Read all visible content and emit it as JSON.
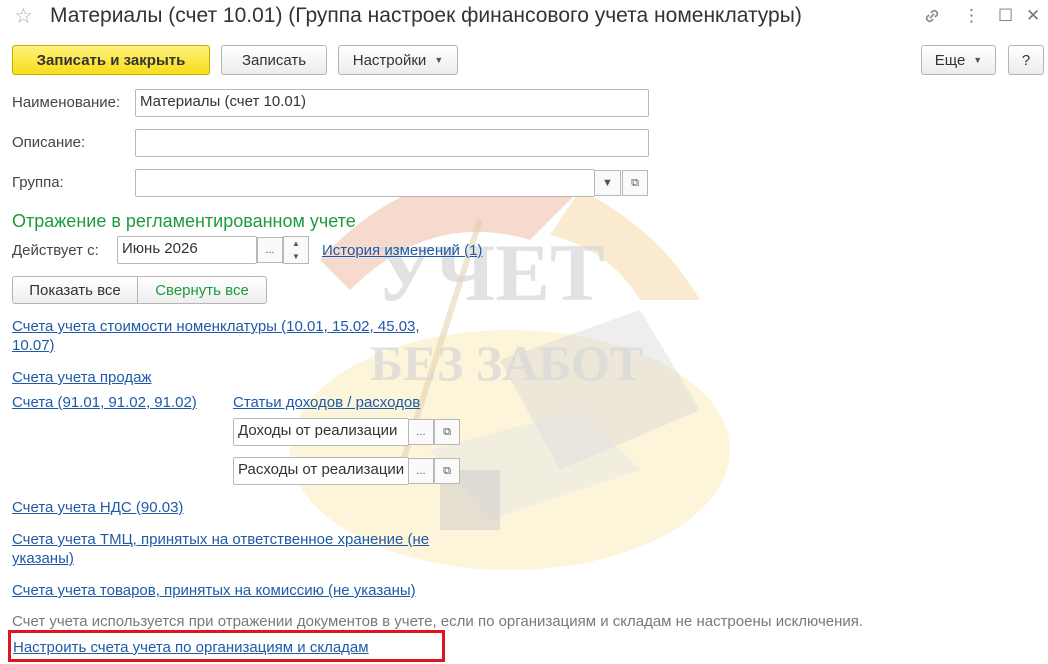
{
  "window": {
    "title": "Материалы (счет 10.01) (Группа настроек финансового учета номенклатуры)",
    "icons": [
      "star-icon",
      "link-icon",
      "more-icon",
      "maximize-icon",
      "close-icon"
    ]
  },
  "toolbar": {
    "save_close_label": "Записать и закрыть",
    "save_label": "Записать",
    "settings_label": "Настройки",
    "more_label": "Еще",
    "help_label": "?"
  },
  "form": {
    "name_label": "Наименование:",
    "name_value": "Материалы (счет 10.01)",
    "description_label": "Описание:",
    "description_value": "",
    "group_label": "Группа:",
    "group_value": ""
  },
  "section": {
    "title": "Отражение в регламентированном учете",
    "effective_label": "Действует с:",
    "effective_value": "Июнь 2026",
    "history_link": "История изменений (1)",
    "show_all": "Показать все",
    "collapse_all": "Свернуть все"
  },
  "links": {
    "cost_accounts_line1": "Счета учета стоимости номенклатуры (10.01, 15.02, 45.03,",
    "cost_accounts_line2": "10.07)",
    "sales_accounts": "Счета учета продаж",
    "accounts_91": "Счета (91.01, 91.02, 91.02)",
    "income_expense_items": "Статьи доходов / расходов",
    "income_field": "Доходы от реализации",
    "expense_field": "Расходы от реализации",
    "vat_accounts": "Счета учета НДС (90.03)",
    "tmc_line1": "Счета учета ТМЦ, принятых на ответственное хранение (не",
    "tmc_line2": "указаны)",
    "commission": "Счета учета товаров, принятых на комиссию (не указаны)",
    "hint": "Счет учета используется при отражении документов в учете, если  по организациям и складам не настроены исключения.",
    "configure": "Настроить счета учета по организациям и складам"
  },
  "watermark": {
    "line1": "УЧЕТ",
    "line2": "БЕЗ ЗАБОТ"
  },
  "colors": {
    "primary_button": "#f7dd1a",
    "section_title": "#1c9b3d",
    "link": "#1e5aa8",
    "highlight_frame": "#e0141e"
  }
}
